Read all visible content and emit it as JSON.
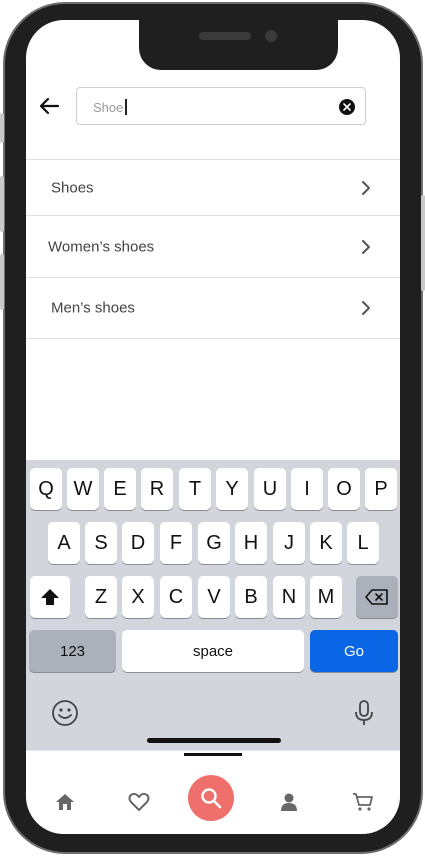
{
  "search": {
    "value": "Shoe",
    "clear_icon": "clear-x-icon",
    "back_icon": "arrow-left-icon"
  },
  "suggestions": [
    {
      "label": "Shoes",
      "icon": "chevron-right-icon"
    },
    {
      "label": "Women’s shoes",
      "icon": "chevron-right-icon"
    },
    {
      "label": "Men’s shoes",
      "icon": "chevron-right-icon"
    }
  ],
  "keyboard": {
    "row1": [
      "Q",
      "W",
      "E",
      "R",
      "T",
      "Y",
      "U",
      "I",
      "O",
      "P"
    ],
    "row2": [
      "A",
      "S",
      "D",
      "F",
      "G",
      "H",
      "J",
      "K",
      "L"
    ],
    "row3": [
      "Z",
      "X",
      "C",
      "V",
      "B",
      "N",
      "M"
    ],
    "numbers_label": "123",
    "space_label": "space",
    "go_label": "Go",
    "shift_icon": "shift-arrow-icon",
    "backspace_icon": "backspace-icon",
    "emoji_icon": "emoji-icon",
    "mic_icon": "microphone-icon"
  },
  "tabbar": {
    "items": [
      "home-icon",
      "heart-icon",
      "search-icon",
      "user-icon",
      "cart-icon"
    ],
    "active": "search-icon"
  },
  "colors": {
    "accent": "#ee6f6b",
    "go_key": "#0a66e4"
  }
}
